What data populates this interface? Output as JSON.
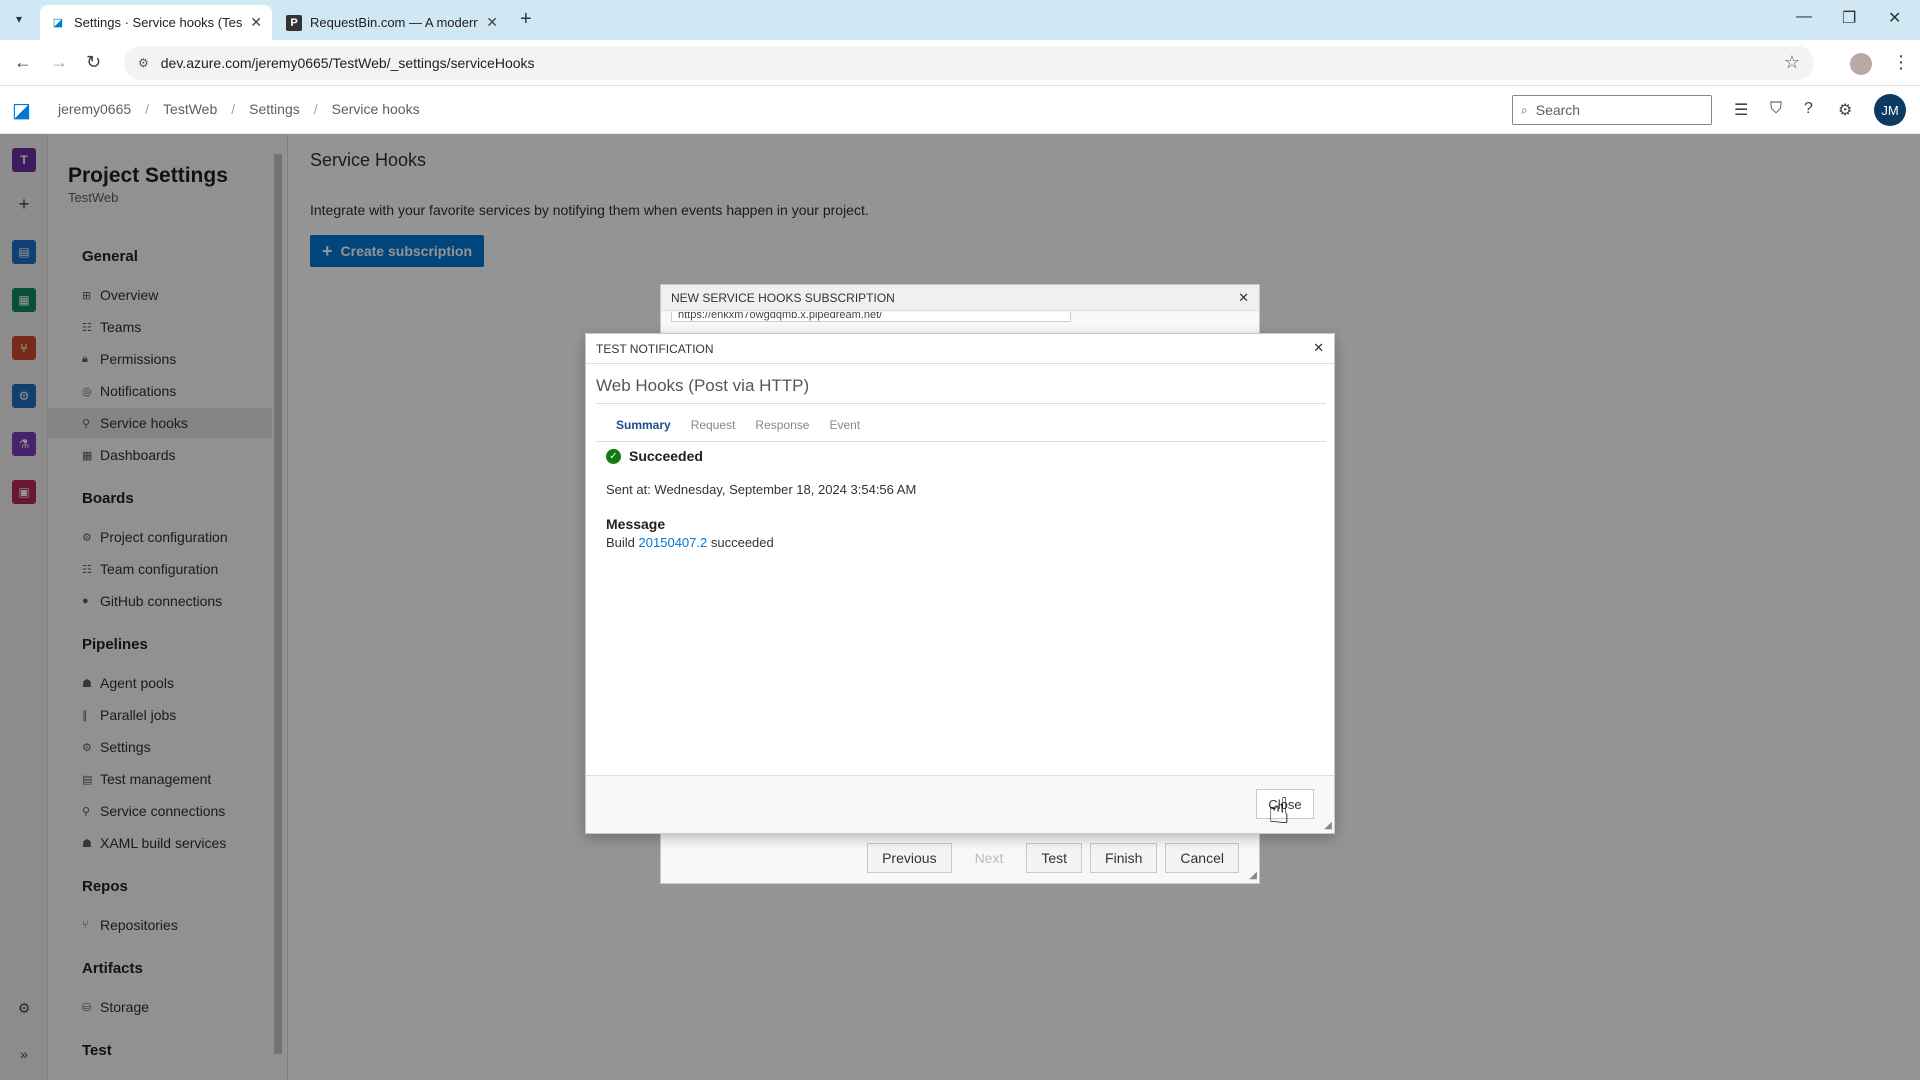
{
  "browser": {
    "tabs": [
      {
        "title": "Settings · Service hooks (TestWeb",
        "active": true
      },
      {
        "title": "RequestBin.com — A modern re",
        "active": false
      }
    ],
    "url": "dev.azure.com/jeremy0665/TestWeb/_settings/serviceHooks"
  },
  "header": {
    "breadcrumbs": [
      "jeremy0665",
      "TestWeb",
      "Settings",
      "Service hooks"
    ],
    "search_placeholder": "Search",
    "avatar_initials": "JM"
  },
  "rail": {
    "project_initial": "T"
  },
  "settings_nav": {
    "title": "Project Settings",
    "subtitle": "TestWeb",
    "groups": [
      {
        "label": "General",
        "items": [
          "Overview",
          "Teams",
          "Permissions",
          "Notifications",
          "Service hooks",
          "Dashboards"
        ]
      },
      {
        "label": "Boards",
        "items": [
          "Project configuration",
          "Team configuration",
          "GitHub connections"
        ]
      },
      {
        "label": "Pipelines",
        "items": [
          "Agent pools",
          "Parallel jobs",
          "Settings",
          "Test management",
          "Service connections",
          "XAML build services"
        ]
      },
      {
        "label": "Repos",
        "items": [
          "Repositories"
        ]
      },
      {
        "label": "Artifacts",
        "items": [
          "Storage"
        ]
      },
      {
        "label": "Test",
        "items": []
      }
    ],
    "selected": "Service hooks"
  },
  "main": {
    "title": "Service Hooks",
    "description": "Integrate with your favorite services by notifying them when events happen in your project.",
    "create_button": "Create subscription"
  },
  "subscription_dialog": {
    "title": "NEW SERVICE HOOKS SUBSCRIPTION",
    "url_partial": "https://enkxm7owgdqmb.x.pipedream.net/",
    "buttons": [
      "Previous",
      "Next",
      "Test",
      "Finish",
      "Cancel"
    ]
  },
  "test_dialog": {
    "title": "TEST NOTIFICATION",
    "service": "Web Hooks (Post via HTTP)",
    "tabs": [
      "Summary",
      "Request",
      "Response",
      "Event"
    ],
    "active_tab": "Summary",
    "status": "Succeeded",
    "sent_at": "Sent at: Wednesday, September 18, 2024 3:54:56 AM",
    "message_heading": "Message",
    "message_prefix": "Build",
    "message_link": "20150407.2",
    "message_suffix": "succeeded",
    "close_button": "Close"
  }
}
